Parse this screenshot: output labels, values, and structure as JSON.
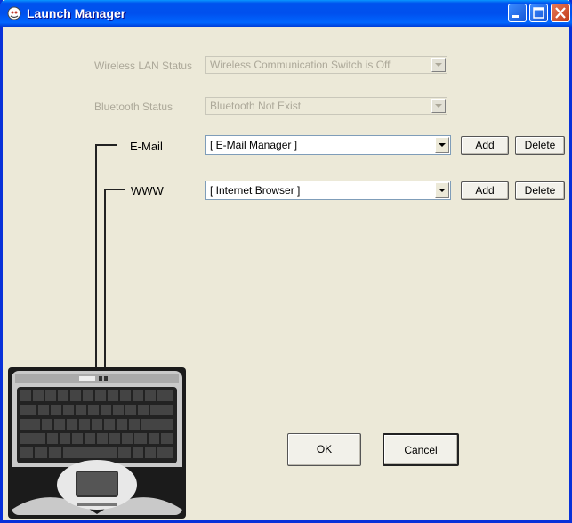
{
  "window": {
    "title": "Launch Manager"
  },
  "wireless": {
    "label": "Wireless LAN Status",
    "value": "Wireless Communication Switch is Off"
  },
  "bluetooth": {
    "label": "Bluetooth Status",
    "value": "Bluetooth Not Exist"
  },
  "email": {
    "label": "E-Mail",
    "value": "[ E-Mail Manager ]",
    "add_label": "Add",
    "delete_label": "Delete"
  },
  "www": {
    "label": "WWW",
    "value": "[ Internet Browser ]",
    "add_label": "Add",
    "delete_label": "Delete"
  },
  "footer": {
    "ok_label": "OK",
    "cancel_label": "Cancel"
  },
  "colors": {
    "titlebar": "#0053ee",
    "dialog_bg": "#ece9d8",
    "disabled_text": "#aca899"
  }
}
